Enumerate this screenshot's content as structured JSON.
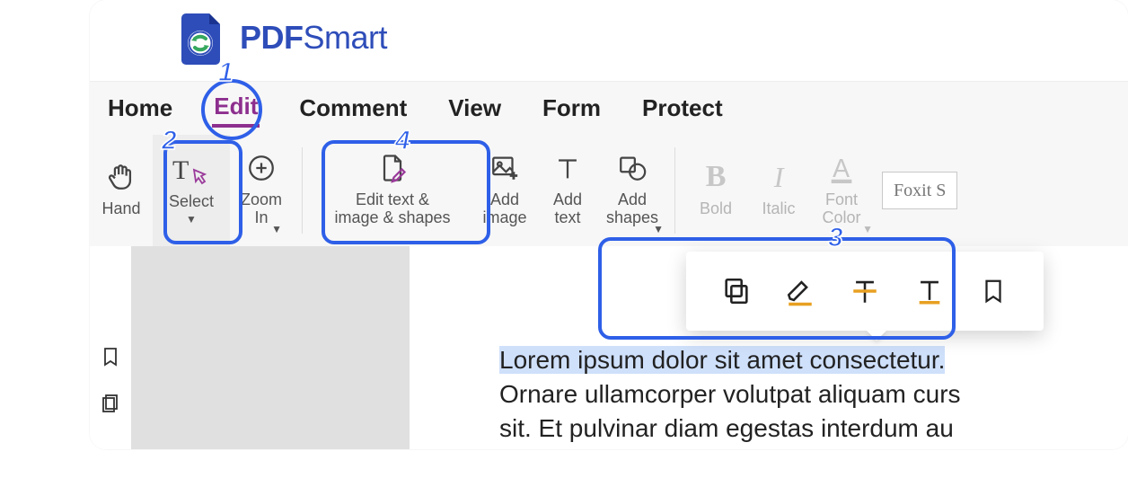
{
  "brand": {
    "strong": "PDF",
    "light": "Smart"
  },
  "tabs": {
    "items": [
      "Home",
      "Edit",
      "Comment",
      "View",
      "Form",
      "Protect"
    ],
    "active_index": 1
  },
  "ribbon": {
    "hand": "Hand",
    "select": "Select",
    "zoom_in": "Zoom\nIn",
    "edit_tis": "Edit text &\nimage & shapes",
    "add_image": "Add\nimage",
    "add_text": "Add\ntext",
    "add_shapes": "Add\nshapes",
    "bold": "Bold",
    "italic": "Italic",
    "font_color": "Font\nColor",
    "font_name": "Foxit S"
  },
  "document": {
    "line1": "Lorem ipsum dolor sit amet consectetur.",
    "line2": "Ornare ullamcorper volutpat aliquam curs",
    "line3": "sit. Et pulvinar diam egestas interdum au"
  },
  "callouts": {
    "n1": "1",
    "n2": "2",
    "n3": "3",
    "n4": "4"
  },
  "colors": {
    "highlight": "#2E5FE8",
    "active_tab": "#8d2f8e",
    "brand": "#2E4DB9"
  }
}
